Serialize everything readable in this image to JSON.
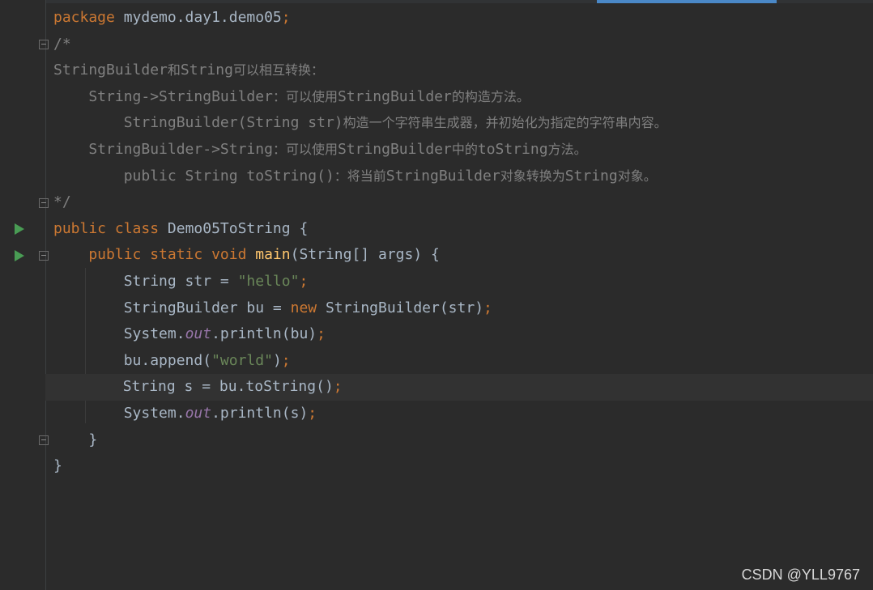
{
  "editor": {
    "lines": [
      {
        "parts": [
          {
            "t": "package ",
            "c": "kw"
          },
          {
            "t": "mydemo.day1.demo05",
            "c": "plain"
          },
          {
            "t": ";",
            "c": "kw"
          }
        ]
      },
      {
        "parts": [
          {
            "t": "/*",
            "c": "cmt"
          }
        ]
      },
      {
        "parts": [
          {
            "t": "StringBuilder",
            "c": "cmt"
          },
          {
            "t": "和",
            "c": "cmt-cn"
          },
          {
            "t": "String",
            "c": "cmt"
          },
          {
            "t": "可以相互转换：",
            "c": "cmt-cn"
          }
        ]
      },
      {
        "parts": [
          {
            "t": "    String->StringBuilder",
            "c": "cmt"
          },
          {
            "t": "：可以使用",
            "c": "cmt-cn"
          },
          {
            "t": "StringBuilder",
            "c": "cmt"
          },
          {
            "t": "的构造方法。",
            "c": "cmt-cn"
          }
        ]
      },
      {
        "parts": [
          {
            "t": "        StringBuilder(String str)",
            "c": "cmt"
          },
          {
            "t": "构造一个字符串生成器，并初始化为指定的字符串内容。",
            "c": "cmt-cn"
          }
        ]
      },
      {
        "parts": [
          {
            "t": "    StringBuilder->String",
            "c": "cmt"
          },
          {
            "t": "：可以使用",
            "c": "cmt-cn"
          },
          {
            "t": "StringBuilder",
            "c": "cmt"
          },
          {
            "t": "中的",
            "c": "cmt-cn"
          },
          {
            "t": "toString",
            "c": "cmt"
          },
          {
            "t": "方法。",
            "c": "cmt-cn"
          }
        ]
      },
      {
        "parts": [
          {
            "t": "        public String toString()",
            "c": "cmt"
          },
          {
            "t": "：将当前",
            "c": "cmt-cn"
          },
          {
            "t": "StringBuilder",
            "c": "cmt"
          },
          {
            "t": "对象转换为",
            "c": "cmt-cn"
          },
          {
            "t": "String",
            "c": "cmt"
          },
          {
            "t": "对象。",
            "c": "cmt-cn"
          }
        ]
      },
      {
        "parts": [
          {
            "t": "*/",
            "c": "cmt"
          }
        ]
      },
      {
        "parts": [
          {
            "t": "public class ",
            "c": "kw"
          },
          {
            "t": "Demo05ToString {",
            "c": "plain"
          }
        ]
      },
      {
        "parts": [
          {
            "t": "    public static void ",
            "c": "kw"
          },
          {
            "t": "main",
            "c": "fn"
          },
          {
            "t": "(String[] args) {",
            "c": "plain"
          }
        ]
      },
      {
        "parts": [
          {
            "t": "        String str = ",
            "c": "plain"
          },
          {
            "t": "\"hello\"",
            "c": "str"
          },
          {
            "t": ";",
            "c": "kw"
          }
        ]
      },
      {
        "parts": [
          {
            "t": "        StringBuilder bu = ",
            "c": "plain"
          },
          {
            "t": "new ",
            "c": "kw"
          },
          {
            "t": "StringBuilder(str)",
            "c": "plain"
          },
          {
            "t": ";",
            "c": "kw"
          }
        ]
      },
      {
        "parts": [
          {
            "t": "        System.",
            "c": "plain"
          },
          {
            "t": "out",
            "c": "field"
          },
          {
            "t": ".println(bu)",
            "c": "plain"
          },
          {
            "t": ";",
            "c": "kw"
          }
        ]
      },
      {
        "parts": [
          {
            "t": "        bu.append(",
            "c": "plain"
          },
          {
            "t": "\"world\"",
            "c": "str"
          },
          {
            "t": ")",
            "c": "plain"
          },
          {
            "t": ";",
            "c": "kw"
          }
        ]
      },
      {
        "parts": [
          {
            "t": "        String s = bu.toString()",
            "c": "plain"
          },
          {
            "t": ";",
            "c": "kw"
          }
        ]
      },
      {
        "parts": [
          {
            "t": "        System.",
            "c": "plain"
          },
          {
            "t": "out",
            "c": "field"
          },
          {
            "t": ".println(s)",
            "c": "plain"
          },
          {
            "t": ";",
            "c": "kw"
          }
        ]
      },
      {
        "parts": [
          {
            "t": "    }",
            "c": "plain"
          }
        ]
      },
      {
        "parts": [
          {
            "t": "}",
            "c": "plain"
          }
        ]
      }
    ],
    "current_line": 14,
    "run_lines": [
      8,
      9
    ],
    "fold_open_lines": [
      1,
      9
    ],
    "fold_close_lines": [
      7,
      16
    ]
  },
  "watermark": "CSDN @YLL9767",
  "colors": {
    "background": "#2b2b2b",
    "keyword": "#cc7832",
    "string": "#6a8759",
    "method": "#ffc66d",
    "field": "#9876aa",
    "comment": "#808080",
    "text": "#a9b7c6",
    "run_icon": "#499c54",
    "tab_indicator": "#4a88c7"
  }
}
